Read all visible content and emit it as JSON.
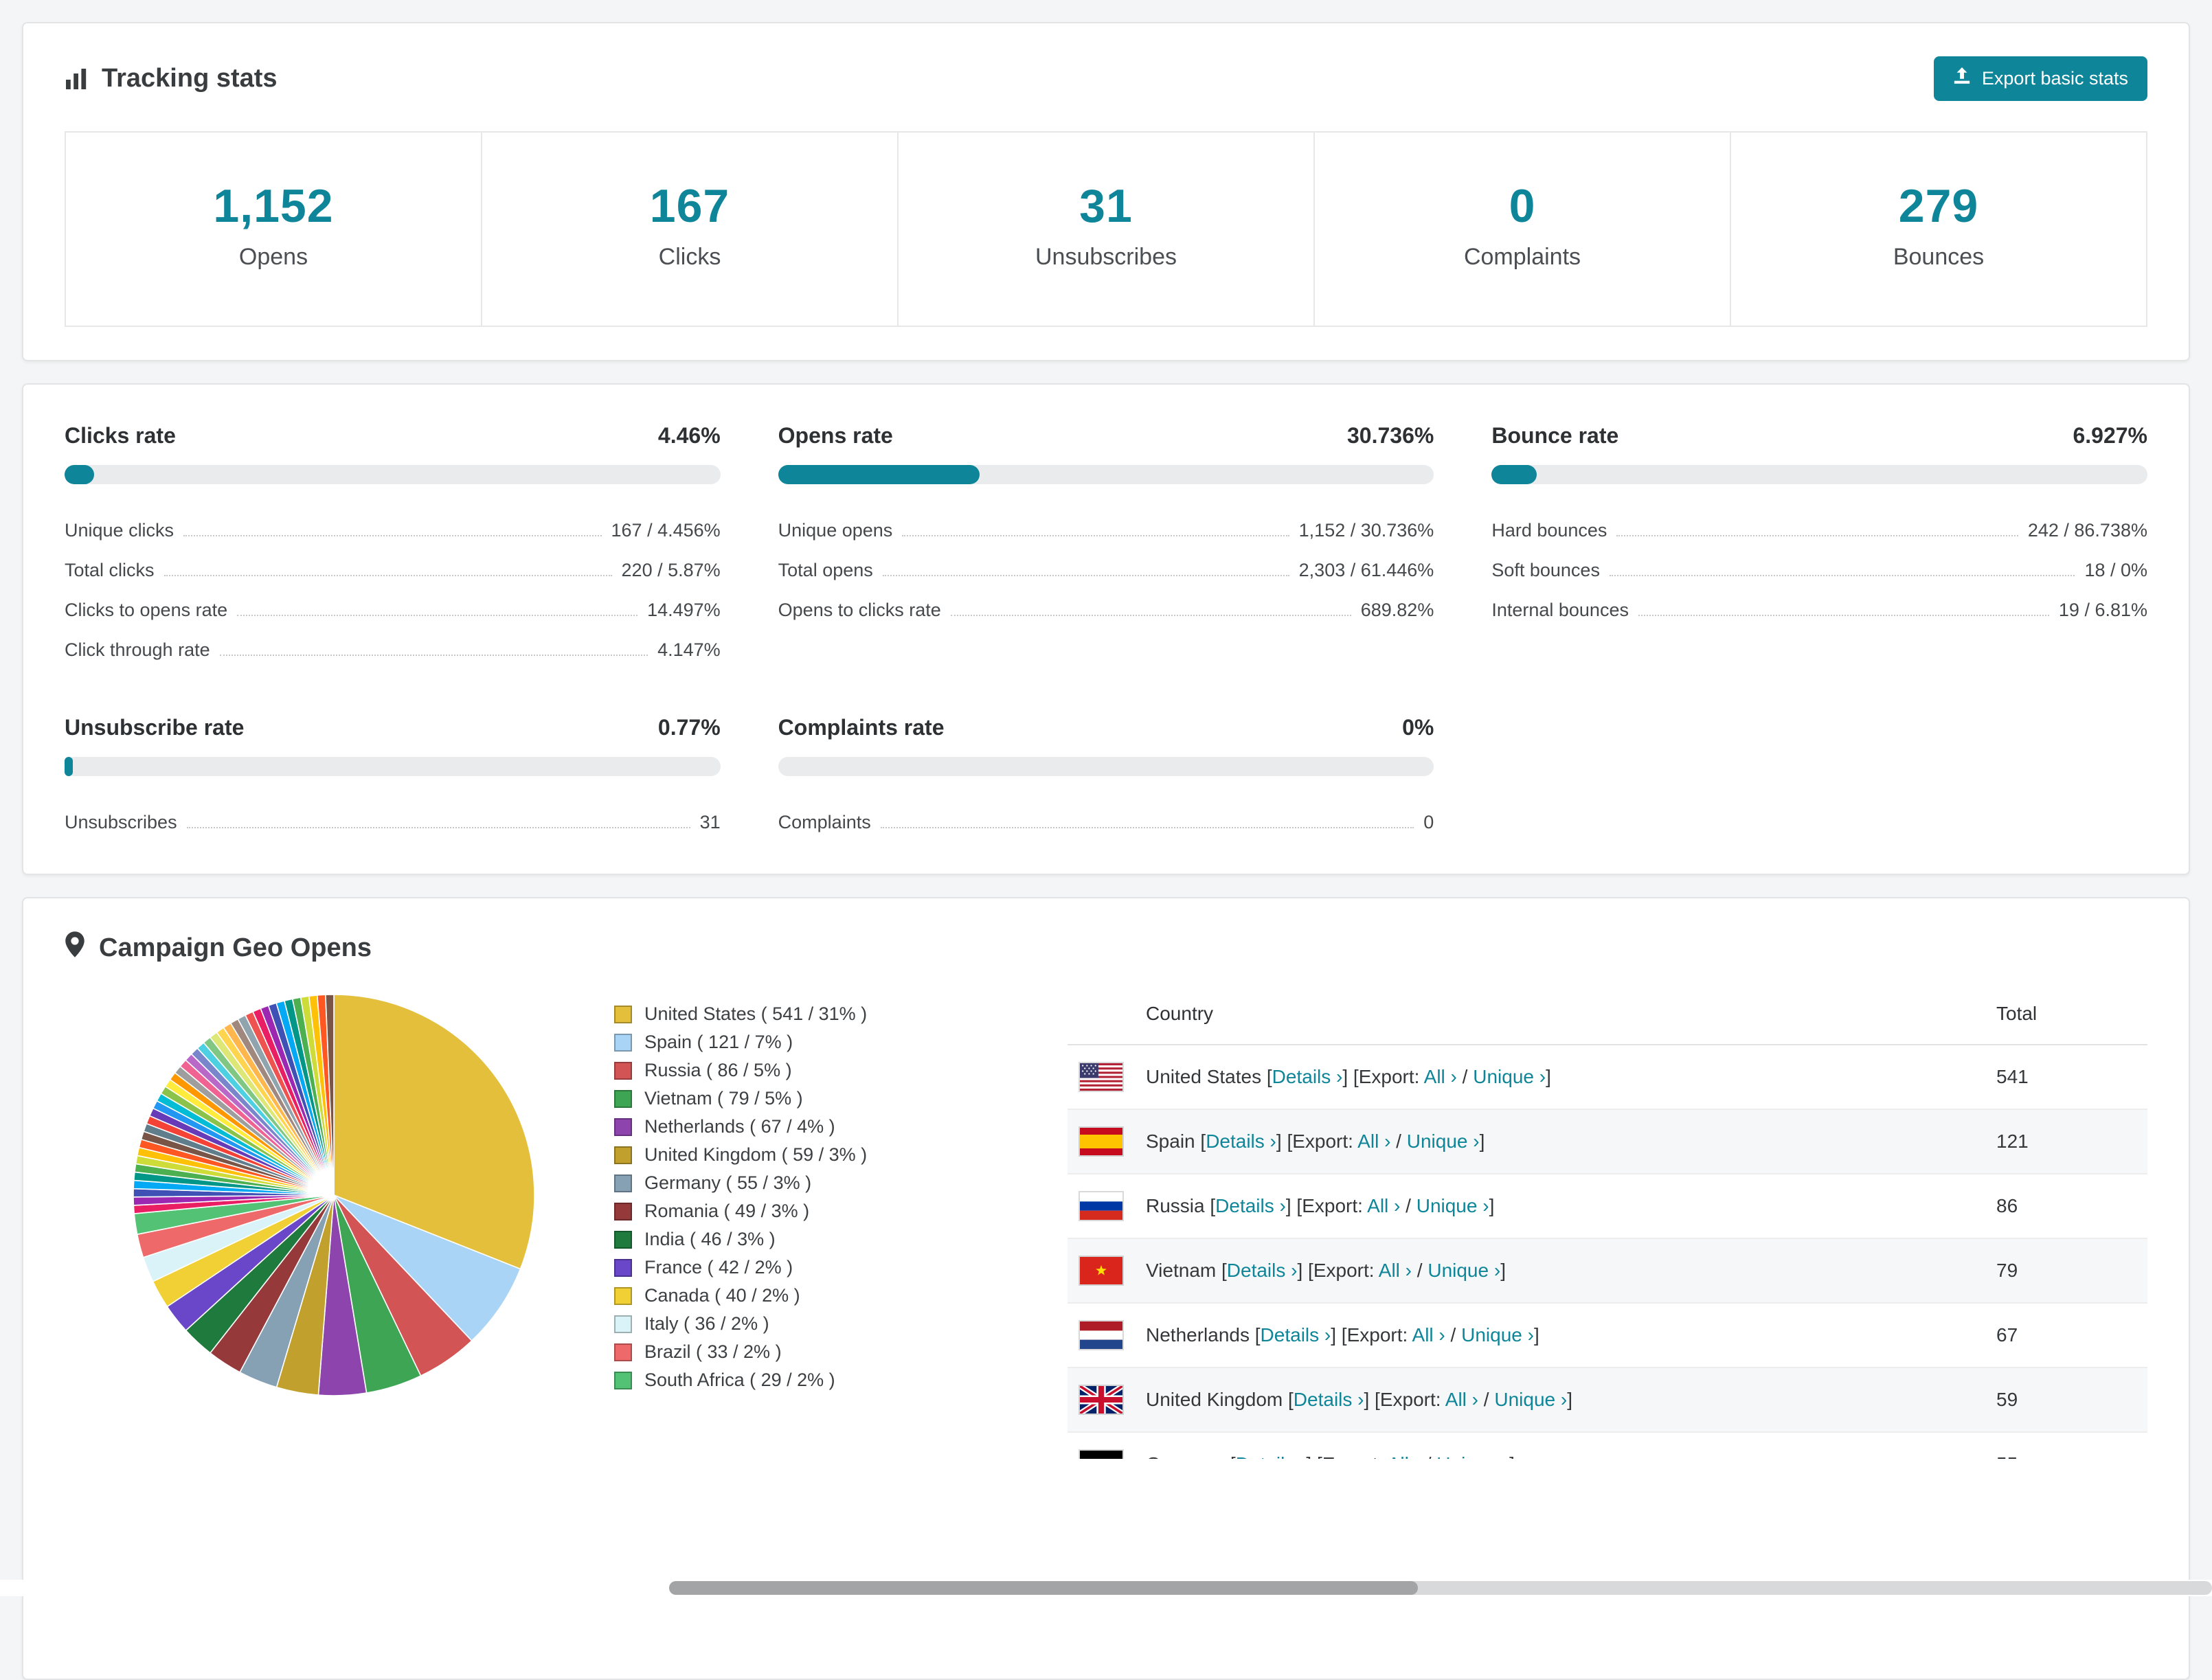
{
  "accent": "#0e8599",
  "header": {
    "title": "Tracking stats",
    "export_label": "Export basic stats"
  },
  "stats": [
    {
      "value": "1,152",
      "label": "Opens"
    },
    {
      "value": "167",
      "label": "Clicks"
    },
    {
      "value": "31",
      "label": "Unsubscribes"
    },
    {
      "value": "0",
      "label": "Complaints"
    },
    {
      "value": "279",
      "label": "Bounces"
    }
  ],
  "rates": [
    {
      "title": "Clicks rate",
      "percent": "4.46%",
      "bar_pct": 4.46,
      "rows": [
        {
          "label": "Unique clicks",
          "value": "167 / 4.456%"
        },
        {
          "label": "Total clicks",
          "value": "220 / 5.87%"
        },
        {
          "label": "Clicks to opens rate",
          "value": "14.497%"
        },
        {
          "label": "Click through rate",
          "value": "4.147%"
        }
      ]
    },
    {
      "title": "Opens rate",
      "percent": "30.736%",
      "bar_pct": 30.736,
      "rows": [
        {
          "label": "Unique opens",
          "value": "1,152 / 30.736%"
        },
        {
          "label": "Total opens",
          "value": "2,303 / 61.446%"
        },
        {
          "label": "Opens to clicks rate",
          "value": "689.82%"
        }
      ]
    },
    {
      "title": "Bounce rate",
      "percent": "6.927%",
      "bar_pct": 6.927,
      "rows": [
        {
          "label": "Hard bounces",
          "value": "242 / 86.738%"
        },
        {
          "label": "Soft bounces",
          "value": "18 / 0%"
        },
        {
          "label": "Internal bounces",
          "value": "19 / 6.81%"
        }
      ]
    },
    {
      "title": "Unsubscribe rate",
      "percent": "0.77%",
      "bar_pct": 0.77,
      "rows": [
        {
          "label": "Unsubscribes",
          "value": "31"
        }
      ]
    },
    {
      "title": "Complaints rate",
      "percent": "0%",
      "bar_pct": 0,
      "rows": [
        {
          "label": "Complaints",
          "value": "0"
        }
      ]
    }
  ],
  "geo": {
    "title": "Campaign Geo Opens",
    "table_headers": {
      "country": "Country",
      "total": "Total"
    },
    "links": {
      "details": "Details",
      "export": "Export:",
      "all": "All",
      "unique": "Unique",
      "chevron": "›"
    },
    "visible_rows": 7
  },
  "chart_data": {
    "type": "pie",
    "title": "Campaign Geo Opens",
    "unit": "opens",
    "legend_position": "right",
    "series": [
      {
        "flag": "us",
        "name": "United States",
        "value": 541,
        "pct": "31%",
        "color": "#e3bf3c"
      },
      {
        "flag": "es",
        "name": "Spain",
        "value": 121,
        "pct": "7%",
        "color": "#a9d4f5"
      },
      {
        "flag": "ru",
        "name": "Russia",
        "value": 86,
        "pct": "5%",
        "color": "#d25454"
      },
      {
        "flag": "vn",
        "name": "Vietnam",
        "value": 79,
        "pct": "5%",
        "color": "#3da554"
      },
      {
        "flag": "nl",
        "name": "Netherlands",
        "value": 67,
        "pct": "4%",
        "color": "#8e44ad"
      },
      {
        "flag": "gb",
        "name": "United Kingdom",
        "value": 59,
        "pct": "3%",
        "color": "#c2a02e"
      },
      {
        "flag": "de",
        "name": "Germany",
        "value": 55,
        "pct": "3%",
        "color": "#86a0b4"
      },
      {
        "flag": "ro",
        "name": "Romania",
        "value": 49,
        "pct": "3%",
        "color": "#96393a"
      },
      {
        "flag": "in",
        "name": "India",
        "value": 46,
        "pct": "3%",
        "color": "#1f7a3d"
      },
      {
        "flag": "fr",
        "name": "France",
        "value": 42,
        "pct": "2%",
        "color": "#6a46c8"
      },
      {
        "flag": "ca",
        "name": "Canada",
        "value": 40,
        "pct": "2%",
        "color": "#f1d036"
      },
      {
        "flag": "it",
        "name": "Italy",
        "value": 36,
        "pct": "2%",
        "color": "#d9f3f8"
      },
      {
        "flag": "br",
        "name": "Brazil",
        "value": 33,
        "pct": "2%",
        "color": "#ee6a6a"
      },
      {
        "flag": "za",
        "name": "South Africa",
        "value": 29,
        "pct": "2%",
        "color": "#53c274"
      }
    ],
    "others": {
      "total": 462,
      "slice_count": 40,
      "palette": [
        "#e91e63",
        "#9c27b0",
        "#3f51b5",
        "#03a9f4",
        "#009688",
        "#4caf50",
        "#cddc39",
        "#ffc107",
        "#ff5722",
        "#795548",
        "#607d8b",
        "#f44336",
        "#673ab7",
        "#2196f3",
        "#00bcd4",
        "#8bc34a",
        "#ffeb3b",
        "#ff9800",
        "#9e9e9e",
        "#f06292",
        "#ba68c8",
        "#7986cb",
        "#4dd0e1",
        "#81c784",
        "#dce775",
        "#ffd54f",
        "#ffb74d",
        "#a1887f",
        "#90a4ae",
        "#ef5350"
      ]
    }
  }
}
